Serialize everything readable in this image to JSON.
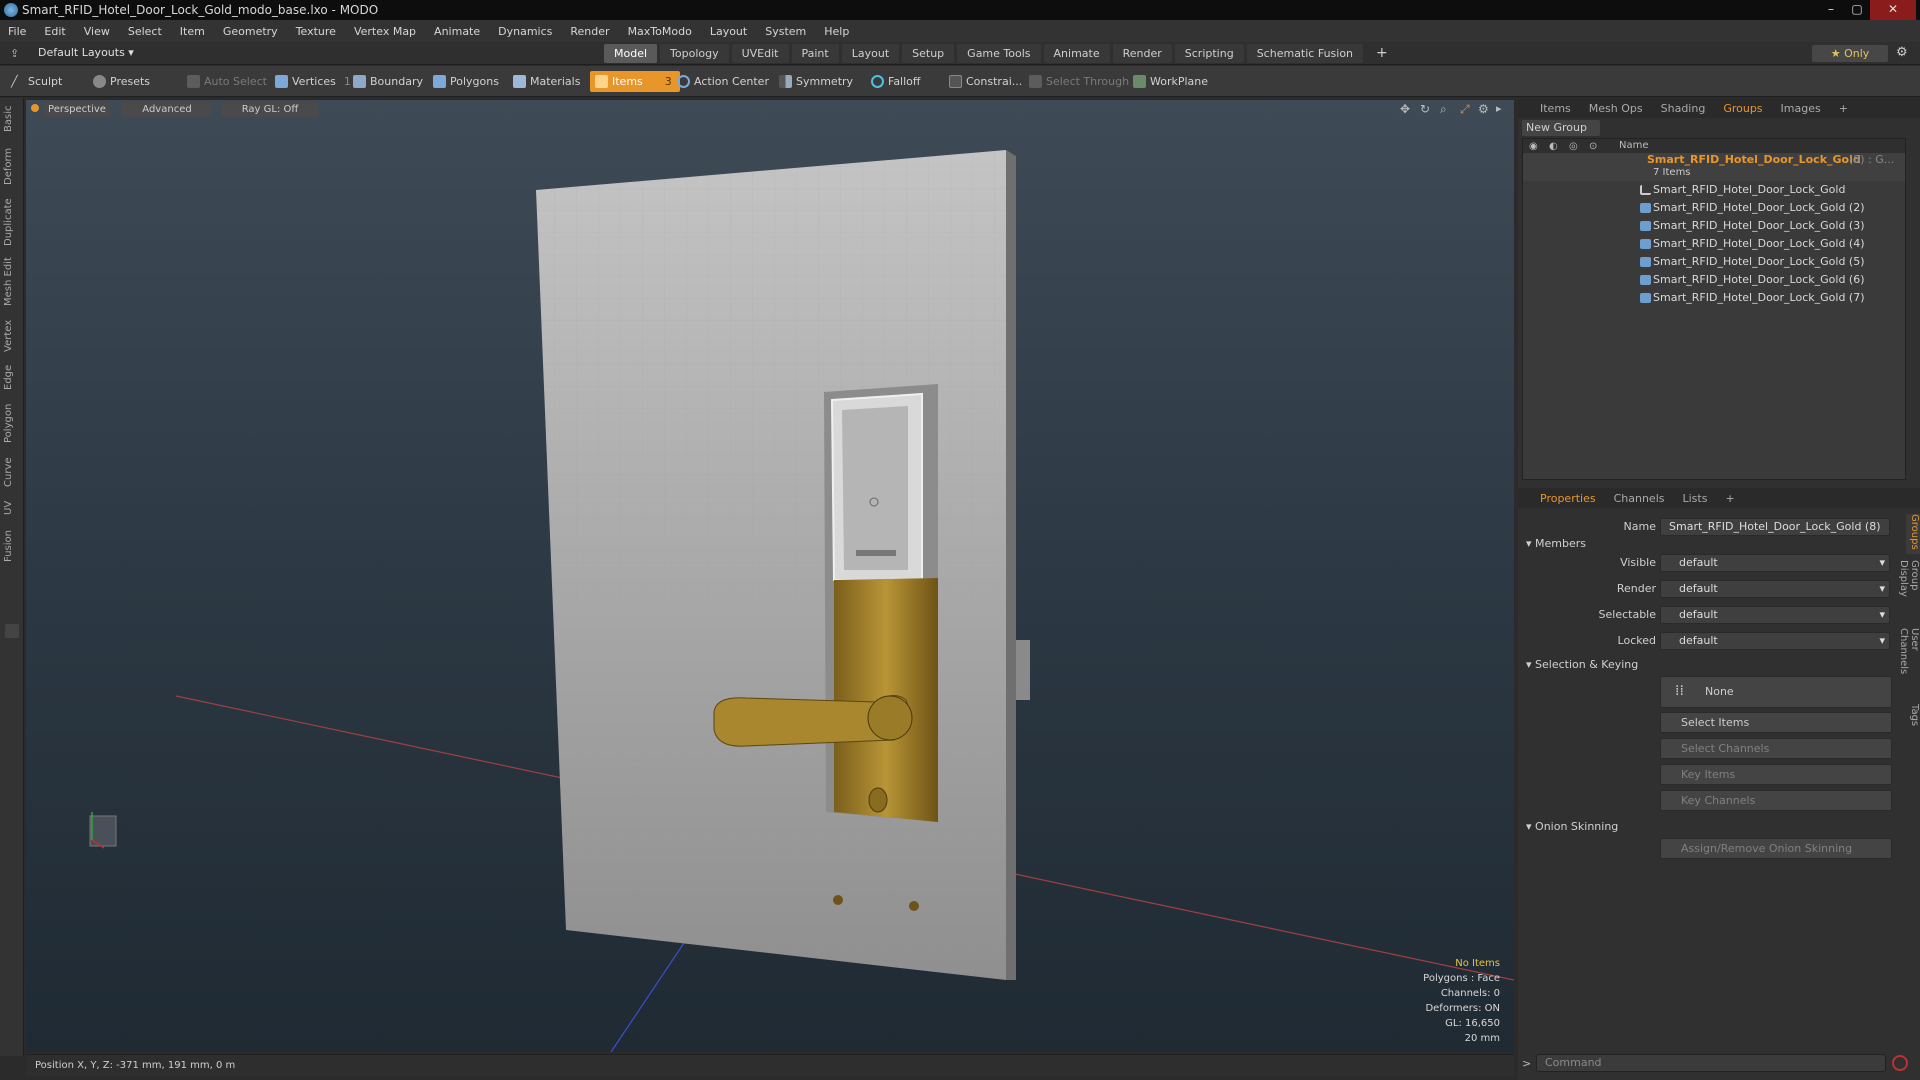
{
  "window": {
    "title": "Smart_RFID_Hotel_Door_Lock_Gold_modo_base.lxo - MODO",
    "minimize": "–",
    "maximize": "▢",
    "close": "✕"
  },
  "menu": [
    "File",
    "Edit",
    "View",
    "Select",
    "Item",
    "Geometry",
    "Texture",
    "Vertex Map",
    "Animate",
    "Dynamics",
    "Render",
    "MaxToModo",
    "Layout",
    "System",
    "Help"
  ],
  "layout": {
    "default_layouts": "Default Layouts ▾",
    "tabs": [
      "Model",
      "Topology",
      "UVEdit",
      "Paint",
      "Layout",
      "Setup",
      "Game Tools",
      "Animate",
      "Render",
      "Scripting",
      "Schematic Fusion"
    ],
    "active_tab": "Model",
    "add": "+",
    "only": "★ Only"
  },
  "toolbar": {
    "sculpt": "Sculpt",
    "presets": "Presets",
    "auto_select": "Auto Select",
    "vertices": "Vertices",
    "vertices_count": "1",
    "boundary": "Boundary",
    "polygons": "Polygons",
    "materials": "Materials",
    "items": "Items",
    "items_count": "3",
    "action_center": "Action Center",
    "symmetry": "Symmetry",
    "falloff": "Falloff",
    "constrain": "Constrai...",
    "select_through": "Select Through",
    "workplane": "WorkPlane"
  },
  "left_tabs": [
    "Basic",
    "Deform",
    "Duplicate",
    "Mesh Edit",
    "Vertex",
    "Edge",
    "Polygon",
    "Curve",
    "UV",
    "Fusion"
  ],
  "viewport": {
    "perspective": "Perspective",
    "advanced": "Advanced",
    "raygl": "Ray GL: Off",
    "hud": [
      "No Items",
      "Polygons : Face",
      "Channels: 0",
      "Deformers: ON",
      "GL: 16,650",
      "20 mm"
    ]
  },
  "status": {
    "position": "Position X, Y, Z:  -371 mm, 191 mm, 0 m"
  },
  "groups_panel": {
    "tabs": [
      "Items",
      "Mesh Ops",
      "Shading",
      "Groups",
      "Images"
    ],
    "active": "Groups",
    "add": "+",
    "new_group": "New Group",
    "name_header": "Name",
    "group_name": "Smart_RFID_Hotel_Door_Lock_Gold",
    "group_suffix": "(8) : G...",
    "item_count": "7 Items",
    "items": [
      "Smart_RFID_Hotel_Door_Lock_Gold",
      "Smart_RFID_Hotel_Door_Lock_Gold (2)",
      "Smart_RFID_Hotel_Door_Lock_Gold (3)",
      "Smart_RFID_Hotel_Door_Lock_Gold (4)",
      "Smart_RFID_Hotel_Door_Lock_Gold (5)",
      "Smart_RFID_Hotel_Door_Lock_Gold (6)",
      "Smart_RFID_Hotel_Door_Lock_Gold (7)"
    ]
  },
  "properties": {
    "tabs": [
      "Properties",
      "Channels",
      "Lists"
    ],
    "active": "Properties",
    "add": "+",
    "name_label": "Name",
    "name_value": "Smart_RFID_Hotel_Door_Lock_Gold (8)",
    "members": "Members",
    "visible_label": "Visible",
    "render_label": "Render",
    "selectable_label": "Selectable",
    "locked_label": "Locked",
    "default": "default",
    "selection_keying": "Selection & Keying",
    "none": "None",
    "select_items": "Select Items",
    "select_channels": "Select Channels",
    "key_items": "Key Items",
    "key_channels": "Key Channels",
    "onion": "Onion Skinning",
    "assign_onion": "Assign/Remove Onion Skinning",
    "side_tabs": [
      "Groups",
      "Group Display",
      "User Channels",
      "Tags"
    ]
  },
  "command": {
    "placeholder": "Command",
    "prompt": ">"
  },
  "colors": {
    "accent": "#e8962a",
    "door": "#b9b9b9",
    "gold": "#a8872e",
    "chrome": "#d9d9d9"
  }
}
